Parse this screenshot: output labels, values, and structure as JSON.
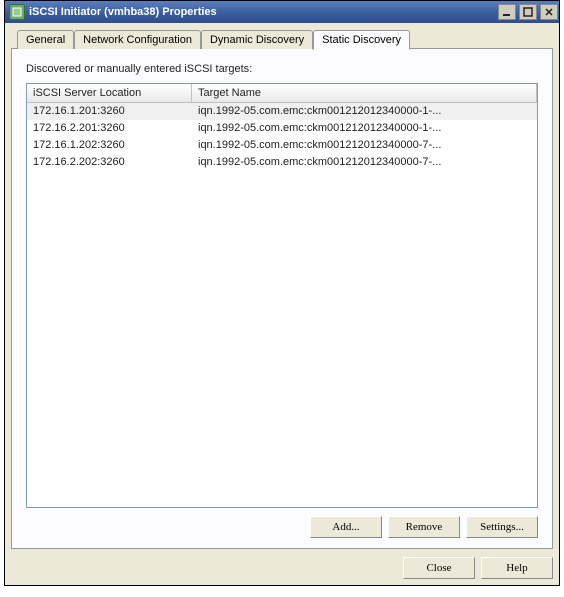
{
  "titlebar": {
    "title": "iSCSI Initiator (vmhba38) Properties"
  },
  "tabs": {
    "general": "General",
    "network": "Network Configuration",
    "dynamic": "Dynamic Discovery",
    "static": "Static Discovery"
  },
  "panel": {
    "description": "Discovered or manually entered iSCSI targets:",
    "columns": {
      "location": "iSCSI Server Location",
      "target": "Target Name"
    },
    "rows": [
      {
        "location": "172.16.1.201:3260",
        "target": "iqn.1992-05.com.emc:ckm001212012340000-1-..."
      },
      {
        "location": "172.16.2.201:3260",
        "target": "iqn.1992-05.com.emc:ckm001212012340000-1-..."
      },
      {
        "location": "172.16.1.202:3260",
        "target": "iqn.1992-05.com.emc:ckm001212012340000-7-..."
      },
      {
        "location": "172.16.2.202:3260",
        "target": "iqn.1992-05.com.emc:ckm001212012340000-7-..."
      }
    ]
  },
  "buttons": {
    "add": "Add...",
    "remove": "Remove",
    "settings": "Settings...",
    "close": "Close",
    "help": "Help"
  }
}
